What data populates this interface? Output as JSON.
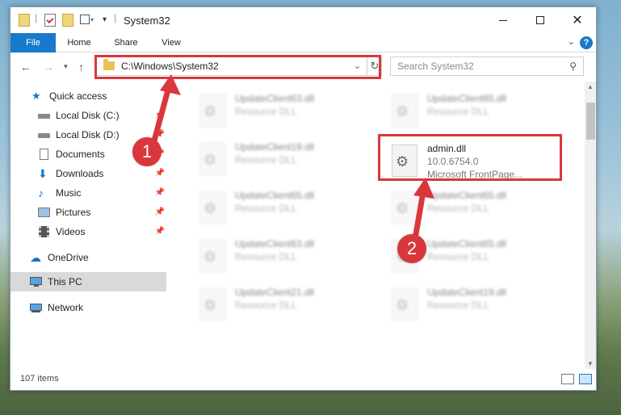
{
  "window": {
    "title": "System32"
  },
  "ribbon": {
    "tabs": [
      "File",
      "Home",
      "Share",
      "View"
    ],
    "help": "?"
  },
  "nav": {
    "address": "C:\\Windows\\System32",
    "search_placeholder": "Search System32"
  },
  "sidebar": {
    "items": [
      {
        "label": "Quick access",
        "icon": "star-icon",
        "pinned": false
      },
      {
        "label": "Local Disk (C:)",
        "icon": "drive-icon",
        "pinned": true
      },
      {
        "label": "Local Disk (D:)",
        "icon": "drive-icon",
        "pinned": true
      },
      {
        "label": "Documents",
        "icon": "documents-icon",
        "pinned": true
      },
      {
        "label": "Downloads",
        "icon": "download-icon",
        "pinned": true
      },
      {
        "label": "Music",
        "icon": "music-icon",
        "pinned": true
      },
      {
        "label": "Pictures",
        "icon": "pictures-icon",
        "pinned": true
      },
      {
        "label": "Videos",
        "icon": "videos-icon",
        "pinned": true
      },
      {
        "label": "OneDrive",
        "icon": "cloud-icon",
        "pinned": false
      },
      {
        "label": "This PC",
        "icon": "pc-icon",
        "pinned": false,
        "selected": true
      },
      {
        "label": "Network",
        "icon": "network-icon",
        "pinned": false
      }
    ]
  },
  "files": {
    "left": [
      {
        "name": "UpdateClient63.dll",
        "type": "Resource DLL"
      },
      {
        "name": "UpdateClient19.dll",
        "type": "Resource DLL"
      },
      {
        "name": "UpdateClient65.dll",
        "type": "Resource DLL"
      },
      {
        "name": "UpdateClient63.dll",
        "type": "Resource DLL"
      },
      {
        "name": "UpdateClient21.dll",
        "type": "Resource DLL"
      }
    ],
    "right": [
      {
        "name": "UpdateClient65.dll",
        "type": "Resource DLL"
      },
      {
        "name": "admin.dll",
        "type": "10.0.6754.0",
        "extra": "Microsoft FrontPage...",
        "highlighted": true
      },
      {
        "name": "UpdateClient65.dll",
        "type": "Resource DLL"
      },
      {
        "name": "UpdateClient65.dll",
        "type": "Resource DLL"
      },
      {
        "name": "UpdateClient19.dll",
        "type": "Resource DLL"
      }
    ]
  },
  "status": {
    "item_count": "107 items"
  },
  "annotations": {
    "callout_1": "1",
    "callout_2": "2"
  },
  "colors": {
    "accent": "#1979ca",
    "annotation_red": "#d9373b",
    "folder": "#e9c357"
  }
}
